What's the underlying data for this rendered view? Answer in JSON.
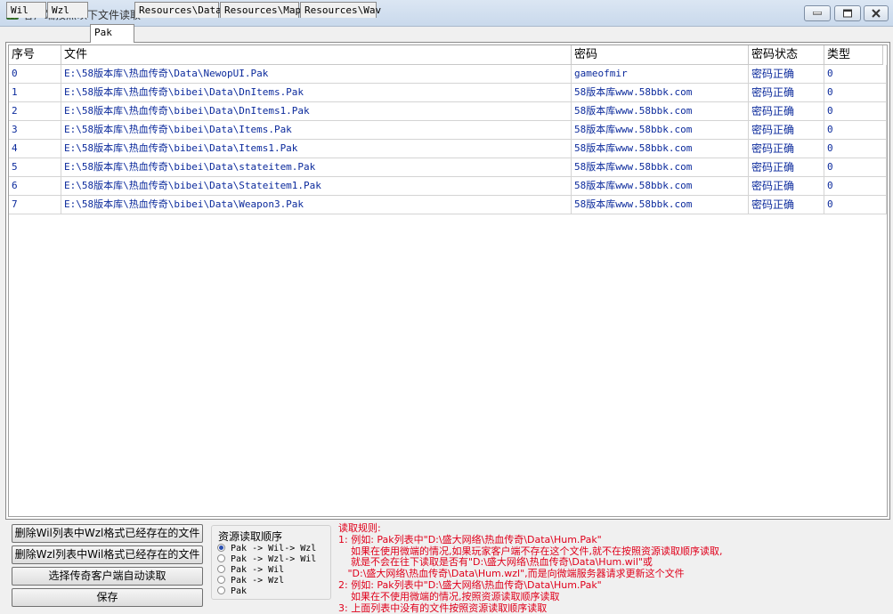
{
  "window": {
    "title": "客户端按照以下文件读取"
  },
  "tabs": [
    {
      "label": "Wil"
    },
    {
      "label": "Wzl"
    },
    {
      "label": "Pak"
    },
    {
      "label": "Resources\\Data"
    },
    {
      "label": "Resources\\Map"
    },
    {
      "label": "Resources\\Wav"
    }
  ],
  "active_tab": "Pak",
  "table": {
    "columns": [
      "序号",
      "文件",
      "密码",
      "密码状态",
      "类型"
    ],
    "rows": [
      {
        "index": "0",
        "file": "E:\\58版本库\\热血传奇\\Data\\NewopUI.Pak",
        "password": "gameofmir",
        "status": "密码正确",
        "type": "0"
      },
      {
        "index": "1",
        "file": "E:\\58版本库\\热血传奇\\bibei\\Data\\DnItems.Pak",
        "password": "58版本库www.58bbk.com",
        "status": "密码正确",
        "type": "0"
      },
      {
        "index": "2",
        "file": "E:\\58版本库\\热血传奇\\bibei\\Data\\DnItems1.Pak",
        "password": "58版本库www.58bbk.com",
        "status": "密码正确",
        "type": "0"
      },
      {
        "index": "3",
        "file": "E:\\58版本库\\热血传奇\\bibei\\Data\\Items.Pak",
        "password": "58版本库www.58bbk.com",
        "status": "密码正确",
        "type": "0"
      },
      {
        "index": "4",
        "file": "E:\\58版本库\\热血传奇\\bibei\\Data\\Items1.Pak",
        "password": "58版本库www.58bbk.com",
        "status": "密码正确",
        "type": "0"
      },
      {
        "index": "5",
        "file": "E:\\58版本库\\热血传奇\\bibei\\Data\\stateitem.Pak",
        "password": "58版本库www.58bbk.com",
        "status": "密码正确",
        "type": "0"
      },
      {
        "index": "6",
        "file": "E:\\58版本库\\热血传奇\\bibei\\Data\\Stateitem1.Pak",
        "password": "58版本库www.58bbk.com",
        "status": "密码正确",
        "type": "0"
      },
      {
        "index": "7",
        "file": "E:\\58版本库\\热血传奇\\bibei\\Data\\Weapon3.Pak",
        "password": "58版本库www.58bbk.com",
        "status": "密码正确",
        "type": "0"
      }
    ]
  },
  "buttons": {
    "delete_wzl_in_wil": "删除Wil列表中Wzl格式已经存在的文件",
    "delete_wil_in_wzl": "删除Wzl列表中Wil格式已经存在的文件",
    "auto_read": "选择传奇客户端自动读取",
    "save": "保存"
  },
  "read_order": {
    "title": "资源读取顺序",
    "options": [
      "Pak -> Wil-> Wzl",
      "Pak -> Wzl-> Wil",
      "Pak -> Wil",
      "Pak -> Wzl",
      "Pak"
    ],
    "selected": "Pak -> Wil-> Wzl"
  },
  "rules": {
    "lines": [
      "读取规则:",
      "1: 例如: Pak列表中\"D:\\盛大网络\\热血传奇\\Data\\Hum.Pak\"",
      "    如果在使用微端的情况,如果玩家客户端不存在这个文件,就不在按照资源读取顺序读取,",
      "    就是不会在往下读取是否有\"D:\\盛大网络\\热血传奇\\Data\\Hum.wil\"或",
      "   \"D:\\盛大网络\\热血传奇\\Data\\Hum.wzl\",而是向微端服务器请求更新这个文件",
      "2: 例如: Pak列表中\"D:\\盛大网络\\热血传奇\\Data\\Hum.Pak\"",
      "    如果在不使用微端的情况,按照资源读取顺序读取",
      "3: 上面列表中没有的文件按照资源读取顺序读取"
    ]
  },
  "colors": {
    "cell_text": "#0b2a9c",
    "rules_text": "#e0001b"
  }
}
